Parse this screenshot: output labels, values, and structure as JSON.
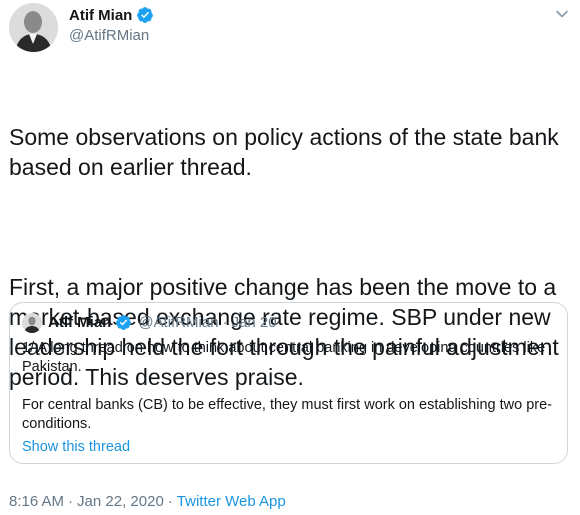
{
  "author": {
    "name": "Atif Mian",
    "handle": "@AtifRMian",
    "verified": true
  },
  "tweet": {
    "paragraphs": [
      "Some observations on policy actions of the state bank based on earlier thread.",
      "First, a major positive change has been the move to a market-based exchange rate regime. SBP under new leadership held the fort through the painful adjustment period. This deserves praise."
    ]
  },
  "quoted_tweet": {
    "name": "Atif Mian",
    "handle": "@AtifRMian",
    "separator": "·",
    "date": "Jan 20",
    "paragraphs": [
      "1/ A long thread on how to think about central banking in developing countries like Pakistan.",
      "For central banks (CB) to be effective, they must first work on establishing two pre-conditions."
    ],
    "show_thread": "Show this thread"
  },
  "footer": {
    "time": "8:16 AM",
    "separator": "·",
    "date": "Jan 22, 2020",
    "source": "Twitter Web App"
  },
  "colors": {
    "link": "#1b95e0",
    "verified": "#1da1f2",
    "secondary_text": "#657786",
    "border": "#ccd6dd"
  },
  "icons": {
    "verified": "verified-badge-icon",
    "more": "chevron-down-icon"
  }
}
